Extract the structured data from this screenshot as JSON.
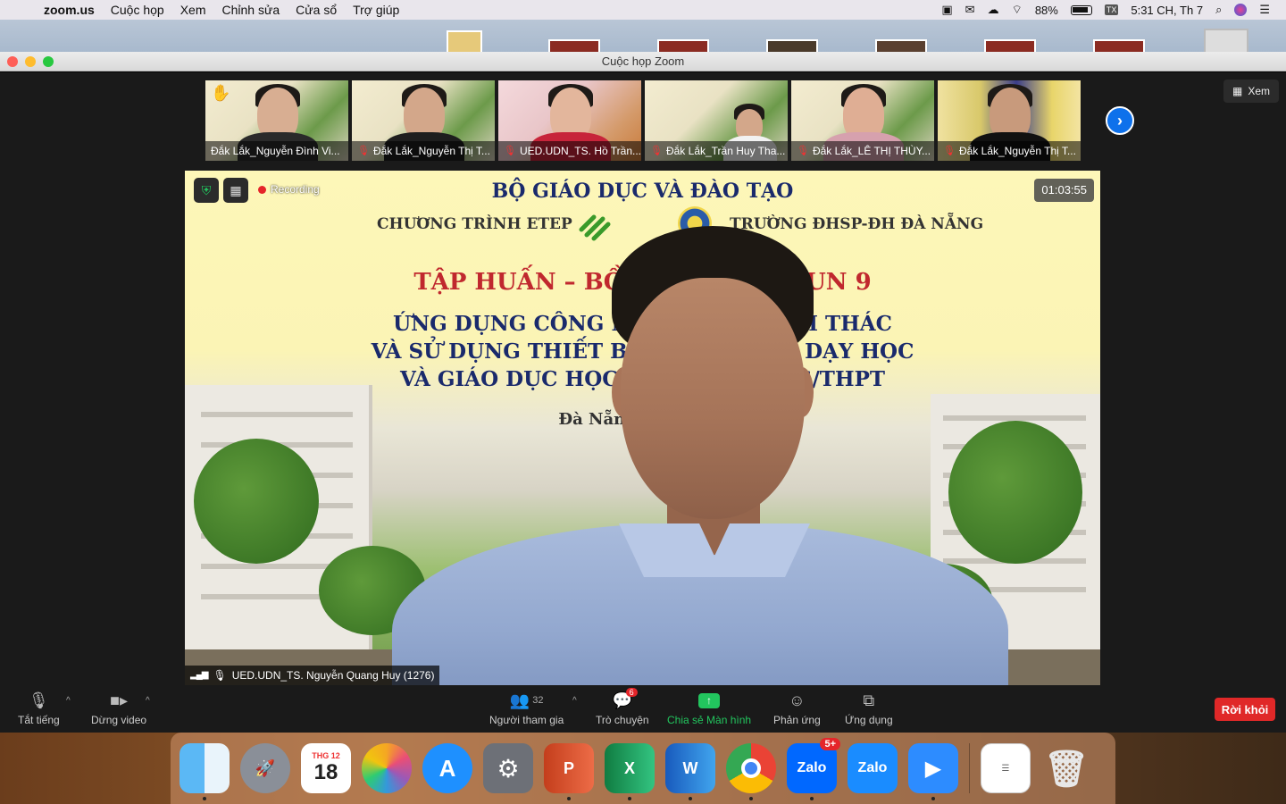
{
  "menubar": {
    "app_name": "zoom.us",
    "items": [
      "Cuộc họp",
      "Xem",
      "Chỉnh sửa",
      "Cửa sổ",
      "Trợ giúp"
    ],
    "battery": "88%",
    "clock": "5:31 CH, Th 7",
    "input_source": "TX"
  },
  "window": {
    "title": "Cuộc họp Zoom"
  },
  "gallery": {
    "view_label": "Xem",
    "participants": [
      {
        "name": "Đắk Lắk_Nguyễn Đình Vi...",
        "muted": false,
        "hand_raised": true
      },
      {
        "name": "Đắk Lắk_Nguyễn Thị T...",
        "muted": true,
        "hand_raised": false
      },
      {
        "name": "UED.UDN_TS. Hồ Trần...",
        "muted": true,
        "hand_raised": false
      },
      {
        "name": "Đắk Lắk_Trần Huy Tha...",
        "muted": true,
        "hand_raised": false
      },
      {
        "name": "Đắk Lắk_LÊ THỊ THÙY...",
        "muted": true,
        "hand_raised": false
      },
      {
        "name": "Đắk Lắk_Nguyễn Thị T...",
        "muted": true,
        "hand_raised": false
      }
    ]
  },
  "main_video": {
    "recording_label": "Recording",
    "timer": "01:03:55",
    "speaker_name": "UED.UDN_TS. Nguyễn Quang Huy (1276)",
    "slide": {
      "ministry": "BỘ GIÁO DỤC VÀ ĐÀO TẠO",
      "program": "CHƯƠNG TRÌNH ETEP",
      "school": "TRƯỜNG ĐHSP-ĐH ĐÀ NẴNG",
      "title": "TẬP HUẤN – BỒ                    ĐUN 9",
      "line1": "ỨNG DỤNG CÔNG N                    HAI THÁC",
      "line2": "VÀ SỬ DỤNG THIẾT BỊ                    G DẠY HỌC",
      "line3": "VÀ GIÁO DỤC HỌC                    HCS/THPT",
      "place": "Đà Nẵng, t"
    }
  },
  "controls": {
    "mute_label": "Tắt tiếng",
    "video_label": "Dừng video",
    "participants_label": "Người tham gia",
    "participants_count": "32",
    "chat_label": "Trò chuyện",
    "chat_badge": "6",
    "share_label": "Chia sẻ Màn hình",
    "reactions_label": "Phản ứng",
    "apps_label": "Ứng dụng",
    "leave_label": "Rời khỏi"
  },
  "dock": {
    "calendar_month": "THG 12",
    "calendar_day": "18",
    "zalo_label": "Zalo",
    "zalo_badge": "5+"
  }
}
